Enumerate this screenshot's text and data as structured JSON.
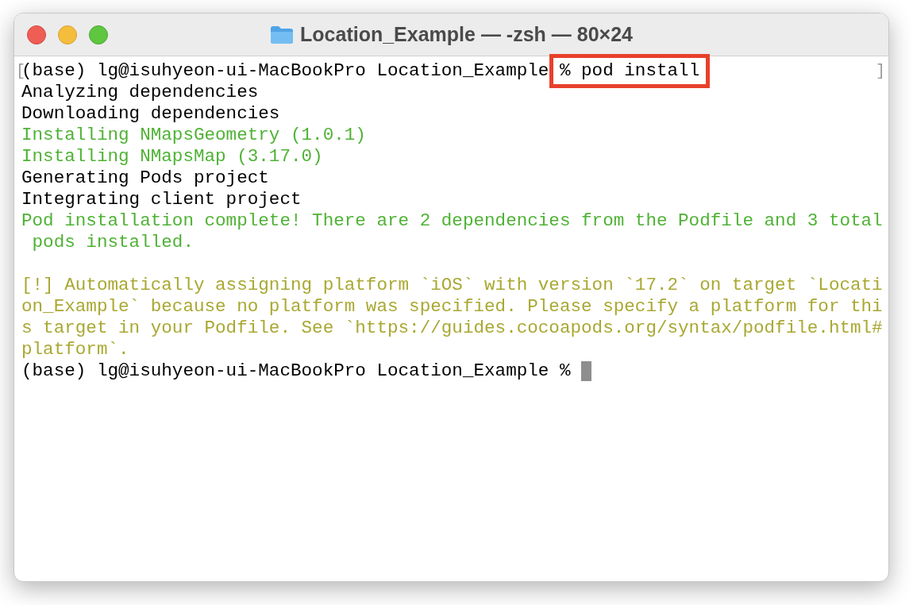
{
  "window": {
    "title": "Location_Example — -zsh — 80×24"
  },
  "terminal": {
    "lines": [
      {
        "kind": "command",
        "open_mark": "[",
        "text": "(base) lg@isuhyeon-ui-MacBookPro Location_Example ",
        "highlighted_text": "% pod install",
        "close_mark": "]"
      },
      {
        "kind": "output",
        "text": "Analyzing dependencies"
      },
      {
        "kind": "output",
        "text": "Downloading dependencies"
      },
      {
        "kind": "success",
        "text": "Installing NMapsGeometry (1.0.1)"
      },
      {
        "kind": "success",
        "text": "Installing NMapsMap (3.17.0)"
      },
      {
        "kind": "output",
        "text": "Generating Pods project"
      },
      {
        "kind": "output",
        "text": "Integrating client project"
      },
      {
        "kind": "success",
        "text": "Pod installation complete! There are 2 dependencies from the Podfile and 3 total"
      },
      {
        "kind": "success",
        "text": " pods installed."
      },
      {
        "kind": "blank"
      },
      {
        "kind": "warning",
        "text": "[!] Automatically assigning platform `iOS` with version `17.2` on target `Locati"
      },
      {
        "kind": "warning",
        "text": "on_Example` because no platform was specified. Please specify a platform for thi"
      },
      {
        "kind": "warning",
        "text": "s target in your Podfile. See `https://guides.cocoapods.org/syntax/podfile.html#"
      },
      {
        "kind": "warning",
        "text": "platform`."
      },
      {
        "kind": "prompt",
        "text": "(base) lg@isuhyeon-ui-MacBookPro Location_Example % ",
        "cursor": true
      }
    ]
  }
}
